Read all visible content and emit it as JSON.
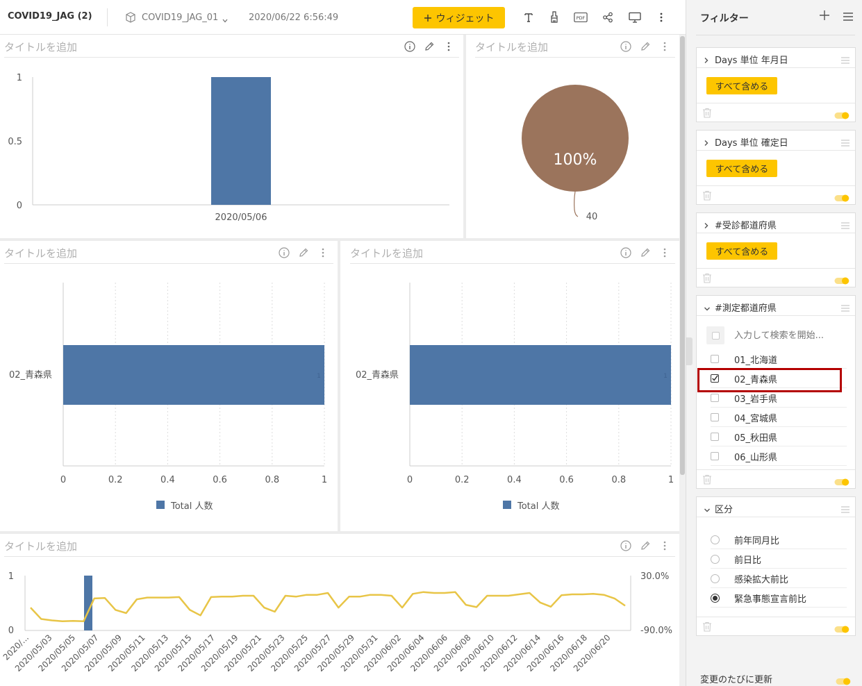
{
  "toolbar": {
    "title": "COVID19_JAG (2)",
    "datasource": "COVID19_JAG_01",
    "timestamp": "2020/06/22 6:56:49",
    "widget_button": "ウィジェット",
    "icons": [
      "text-icon",
      "brush-icon",
      "pdf-icon",
      "share-icon",
      "monitor-icon",
      "more-icon"
    ]
  },
  "widgets": {
    "w1": {
      "title": "タイトルを追加"
    },
    "w2": {
      "title": "タイトルを追加"
    },
    "w3": {
      "title": "タイトルを追加",
      "legend": "Total 人数"
    },
    "w4": {
      "title": "タイトルを追加",
      "legend": "Total 人数"
    },
    "w5": {
      "title": "タイトルを追加"
    }
  },
  "chart_data": [
    {
      "type": "bar",
      "categories": [
        "2020/05/06"
      ],
      "values": [
        1
      ],
      "ylim": [
        0,
        1
      ],
      "yticks": [
        "1",
        "0.5",
        "0"
      ],
      "color": "#4e76a6"
    },
    {
      "type": "pie",
      "labels": [
        "40"
      ],
      "values": [
        40
      ],
      "percent_label": "100%",
      "color": "#9b745c"
    },
    {
      "type": "bar",
      "orientation": "horizontal",
      "categories": [
        "02_青森県"
      ],
      "values": [
        1
      ],
      "value_label": "1",
      "xlim": [
        0,
        1
      ],
      "xticks": [
        "0",
        "0.2",
        "0.4",
        "0.6",
        "0.8",
        "1"
      ],
      "legend": "Total 人数",
      "color": "#4e76a6"
    },
    {
      "type": "bar",
      "orientation": "horizontal",
      "categories": [
        "02_青森県"
      ],
      "values": [
        1
      ],
      "value_label": "1",
      "xlim": [
        0,
        1
      ],
      "xticks": [
        "0",
        "0.2",
        "0.4",
        "0.6",
        "0.8",
        "1"
      ],
      "legend": "Total 人数",
      "color": "#4e76a6"
    },
    {
      "type": "line",
      "x_labels": [
        "2020/...",
        "2020/05/03",
        "2020/05/05",
        "2020/05/07",
        "2020/05/09",
        "2020/05/11",
        "2020/05/13",
        "2020/05/15",
        "2020/05/17",
        "2020/05/19",
        "2020/05/21",
        "2020/05/23",
        "2020/05/25",
        "2020/05/27",
        "2020/05/29",
        "2020/05/31",
        "2020/06/02",
        "2020/06/04",
        "2020/06/06",
        "2020/06/08",
        "2020/06/10",
        "2020/06/12",
        "2020/06/14",
        "2020/06/16",
        "2020/06/18",
        "2020/06/20"
      ],
      "left_ticks": [
        "1",
        "0"
      ],
      "right_ticks": [
        "30.0%",
        "-90.0%"
      ],
      "bar": {
        "index": 4,
        "value": 1,
        "color": "#4e76a6"
      },
      "line_color": "#e8c547",
      "line_values": [
        -40,
        -65,
        -68,
        -70,
        -69,
        -70,
        -20,
        -19,
        -45,
        -52,
        -22,
        -18,
        -18,
        -18,
        -17,
        -45,
        -57,
        -17,
        -16,
        -16,
        -14,
        -14,
        -40,
        -49,
        -14,
        -16,
        -12,
        -12,
        -8,
        -40,
        -16,
        -16,
        -12,
        -12,
        -14,
        -40,
        -10,
        -6,
        -8,
        -8,
        -6,
        -34,
        -39,
        -14,
        -14,
        -14,
        -11,
        -8,
        -29,
        -38,
        -13,
        -11,
        -11,
        -10,
        -12,
        -20,
        -36
      ],
      "ylim_left": [
        0,
        1
      ],
      "ylim_right": [
        -90,
        30
      ]
    }
  ],
  "filters": {
    "title": "フィルター",
    "include_all": "すべて含める",
    "f1": {
      "label": "Days 単位 年月日"
    },
    "f2": {
      "label": "Days 単位 確定日"
    },
    "f3": {
      "label": "#受診都道府県"
    },
    "f4": {
      "label": "#測定都道府県",
      "search_placeholder": "入力して検索を開始...",
      "options": [
        {
          "label": "01_北海道",
          "checked": false
        },
        {
          "label": "02_青森県",
          "checked": true
        },
        {
          "label": "03_岩手県",
          "checked": false
        },
        {
          "label": "04_宮城県",
          "checked": false
        },
        {
          "label": "05_秋田県",
          "checked": false
        },
        {
          "label": "06_山形県",
          "checked": false
        }
      ]
    },
    "f5": {
      "label": "区分",
      "options": [
        {
          "label": "前年同月比",
          "selected": false
        },
        {
          "label": "前日比",
          "selected": false
        },
        {
          "label": "感染拡大前比",
          "selected": false
        },
        {
          "label": "緊急事態宣言前比",
          "selected": true
        }
      ]
    },
    "auto_update": "変更のたびに更新"
  },
  "colors": {
    "accent": "#fdc500",
    "bar": "#4e76a6",
    "pie": "#9b745c",
    "highlight": "#b40000"
  }
}
